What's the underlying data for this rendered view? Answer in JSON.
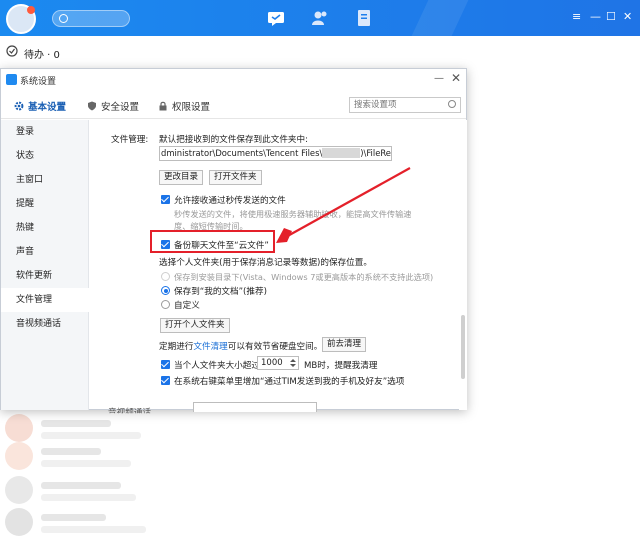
{
  "topbar": {
    "nav_icons": [
      "message-icon",
      "contacts-icon",
      "document-icon"
    ],
    "window_controls": [
      "≡",
      "—",
      "☐",
      "✕"
    ]
  },
  "todo": {
    "label": "待办 · 0"
  },
  "dialog": {
    "title": "系统设置",
    "minimize": "—",
    "close": "✕",
    "tabs": [
      {
        "label": "基本设置",
        "icon": "gear-icon",
        "active": true
      },
      {
        "label": "安全设置",
        "icon": "shield-icon",
        "active": false
      },
      {
        "label": "权限设置",
        "icon": "lock-icon",
        "active": false
      }
    ],
    "search_placeholder": "搜索设置项",
    "nav": [
      {
        "label": "登录"
      },
      {
        "label": "状态"
      },
      {
        "label": "主窗口"
      },
      {
        "label": "提醒"
      },
      {
        "label": "热键"
      },
      {
        "label": "声音"
      },
      {
        "label": "软件更新"
      },
      {
        "label": "文件管理",
        "active": true
      },
      {
        "label": "音视频通话"
      }
    ],
    "file_mgmt": {
      "section_label": "文件管理:",
      "default_save_text": "默认把接收到的文件保存到此文件夹中:",
      "path_prefix": "dministrator\\Documents\\Tencent Files\\",
      "path_suffix": ")\\FileRecv\\",
      "change_dir_button": "更改目录",
      "open_folder_button": "打开文件夹",
      "allow_fast_transfer": "允许接收通过秒传发送的文件",
      "fast_transfer_desc_1": "秒传发送的文件，将使用极速服务器辅助接收，能提高文件传输速",
      "fast_transfer_desc_2": "度、缩短传输时间。",
      "backup_chat_files": "备份聊天文件至“云文件”",
      "personal_folder_text": "选择个人文件夹(用于保存消息记录等数据)的保存位置。",
      "radio_install_dir": "保存到安装目录下(Vista、Windows 7或更高版本的系统不支持此选项)",
      "radio_my_docs": "保存到“我的文档”(推荐)",
      "radio_custom": "自定义",
      "open_personal_folder_button": "打开个人文件夹",
      "periodic_prefix": "定期进行",
      "periodic_link": "文件清理",
      "periodic_suffix": "可以有效节省硬盘空间。",
      "go_clean_button": "前去清理",
      "size_limit_prefix": "当个人文件夹大小超过",
      "size_limit_value": "1000",
      "size_limit_suffix": "MB时，提醒我清理",
      "context_menu_option": "在系统右键菜单里增加“通过TIM发送到我的手机及好友”选项"
    },
    "cut_off_label": "音视频通话"
  },
  "colors": {
    "accent": "#1a73e8",
    "topbar": "#1f7fec",
    "highlight_red": "#e4202a"
  }
}
